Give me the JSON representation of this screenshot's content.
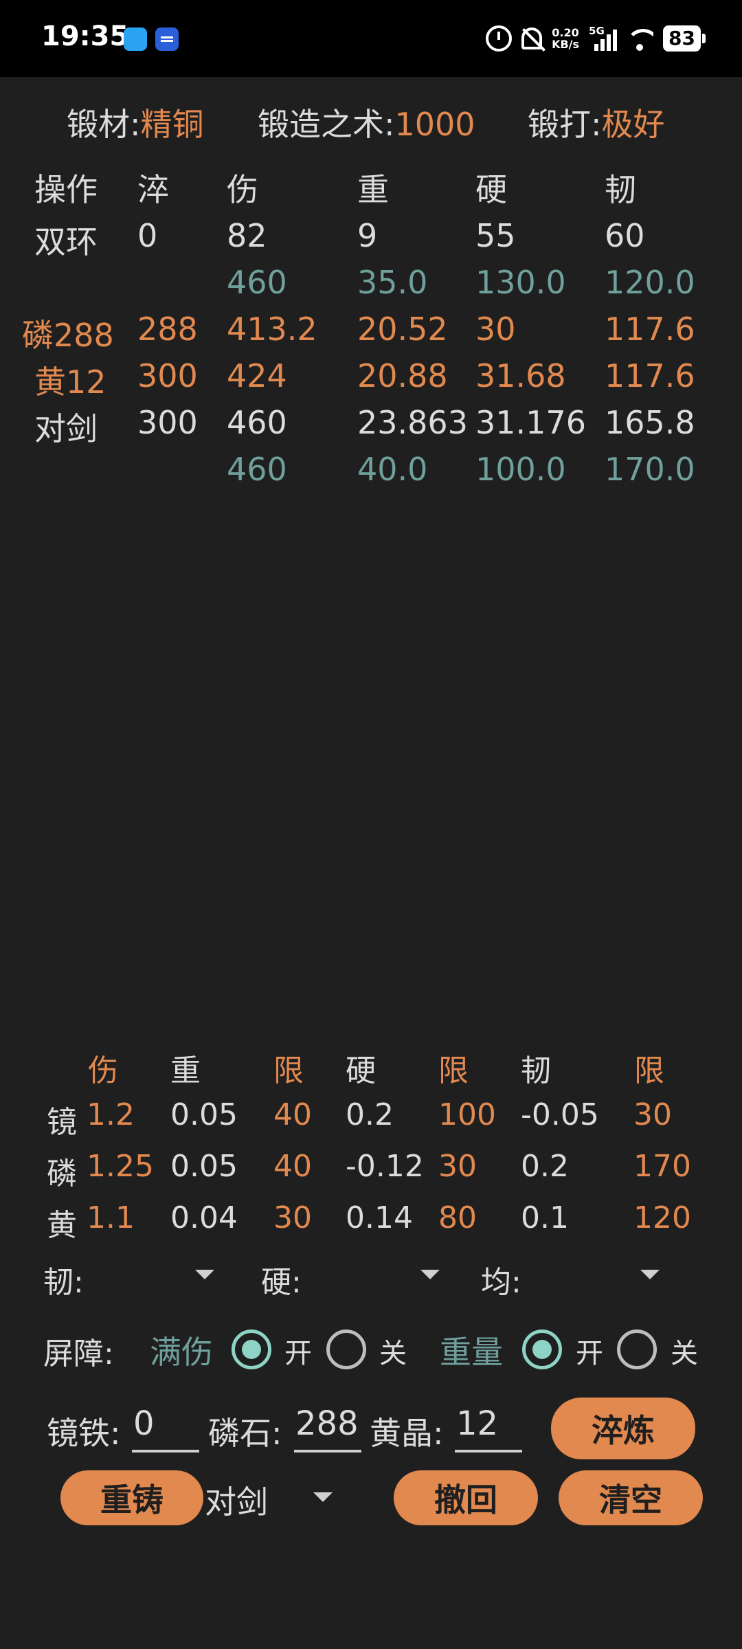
{
  "status": {
    "time": "19:35",
    "speed_value": "0.20",
    "speed_unit": "KB/s",
    "network": "5G",
    "battery": "83"
  },
  "header": {
    "material_label": "锻材:",
    "material_value": "精铜",
    "skill_label": "锻造之术:",
    "skill_value": "1000",
    "forge_label": "锻打:",
    "forge_value": "极好"
  },
  "top_table": {
    "headers": [
      "操作",
      "淬",
      "伤",
      "重",
      "硬",
      "韧"
    ],
    "rows": [
      [
        "双环",
        "0",
        "82",
        "9",
        "55",
        "60"
      ],
      [
        "",
        "",
        "460",
        "35.0",
        "130.0",
        "120.0"
      ],
      [
        "磷288",
        "288",
        "413.2",
        "20.52",
        "30",
        "117.6"
      ],
      [
        "黄12",
        "300",
        "424",
        "20.88",
        "31.68",
        "117.6"
      ],
      [
        "对剑",
        "300",
        "460",
        "23.863",
        "31.176",
        "165.8"
      ],
      [
        "",
        "",
        "460",
        "40.0",
        "100.0",
        "170.0"
      ]
    ]
  },
  "bottom_table": {
    "headers": [
      "伤",
      "重",
      "限",
      "硬",
      "限",
      "韧",
      "限"
    ],
    "rows": [
      [
        "镜",
        "1.2",
        "0.05",
        "40",
        "0.2",
        "100",
        "-0.05",
        "30"
      ],
      [
        "磷",
        "1.25",
        "0.05",
        "40",
        "-0.12",
        "30",
        "0.2",
        "170"
      ],
      [
        "黄",
        "1.1",
        "0.04",
        "30",
        "0.14",
        "80",
        "0.1",
        "120"
      ]
    ]
  },
  "dropdowns": {
    "tough": "韧:",
    "hard": "硬:",
    "even": "均:"
  },
  "barrier": {
    "label": "屏障:",
    "full_damage": "满伤",
    "on1": "开",
    "off1": "关",
    "weight": "重量",
    "on2": "开",
    "off2": "关"
  },
  "inputs": {
    "mirror_label": "镜铁:",
    "mirror_value": "0",
    "phos_label": "磷石:",
    "phos_value": "288",
    "yellow_label": "黄晶:",
    "yellow_value": "12"
  },
  "buttons": {
    "quench": "淬炼",
    "recast": "重铸",
    "weapon_select": "对剑",
    "undo": "撤回",
    "clear": "清空"
  }
}
